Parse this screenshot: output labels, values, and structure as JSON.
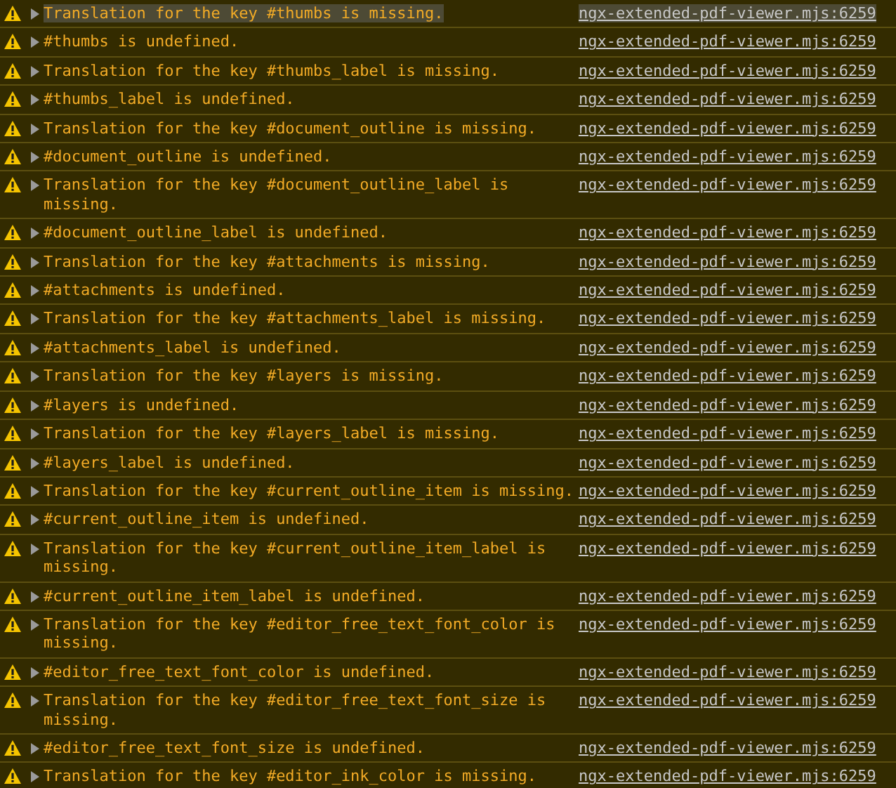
{
  "console": {
    "messages": [
      {
        "text": "Translation for the key #thumbs is missing.",
        "source": "ngx-extended-pdf-viewer.mjs:6259",
        "selected": true
      },
      {
        "text": "#thumbs is undefined.",
        "source": "ngx-extended-pdf-viewer.mjs:6259",
        "selected": false
      },
      {
        "text": "Translation for the key #thumbs_label is missing.",
        "source": "ngx-extended-pdf-viewer.mjs:6259",
        "selected": false
      },
      {
        "text": "#thumbs_label is undefined.",
        "source": "ngx-extended-pdf-viewer.mjs:6259",
        "selected": false
      },
      {
        "text": "Translation for the key #document_outline is missing.",
        "source": "ngx-extended-pdf-viewer.mjs:6259",
        "selected": false
      },
      {
        "text": "#document_outline is undefined.",
        "source": "ngx-extended-pdf-viewer.mjs:6259",
        "selected": false
      },
      {
        "text": "Translation for the key #document_outline_label is missing.",
        "source": "ngx-extended-pdf-viewer.mjs:6259",
        "selected": false
      },
      {
        "text": "#document_outline_label is undefined.",
        "source": "ngx-extended-pdf-viewer.mjs:6259",
        "selected": false
      },
      {
        "text": "Translation for the key #attachments is missing.",
        "source": "ngx-extended-pdf-viewer.mjs:6259",
        "selected": false
      },
      {
        "text": "#attachments is undefined.",
        "source": "ngx-extended-pdf-viewer.mjs:6259",
        "selected": false
      },
      {
        "text": "Translation for the key #attachments_label is missing.",
        "source": "ngx-extended-pdf-viewer.mjs:6259",
        "selected": false
      },
      {
        "text": "#attachments_label is undefined.",
        "source": "ngx-extended-pdf-viewer.mjs:6259",
        "selected": false
      },
      {
        "text": "Translation for the key #layers is missing.",
        "source": "ngx-extended-pdf-viewer.mjs:6259",
        "selected": false
      },
      {
        "text": "#layers is undefined.",
        "source": "ngx-extended-pdf-viewer.mjs:6259",
        "selected": false
      },
      {
        "text": "Translation for the key #layers_label is missing.",
        "source": "ngx-extended-pdf-viewer.mjs:6259",
        "selected": false
      },
      {
        "text": "#layers_label is undefined.",
        "source": "ngx-extended-pdf-viewer.mjs:6259",
        "selected": false
      },
      {
        "text": "Translation for the key #current_outline_item is missing.",
        "source": "ngx-extended-pdf-viewer.mjs:6259",
        "selected": false
      },
      {
        "text": "#current_outline_item is undefined.",
        "source": "ngx-extended-pdf-viewer.mjs:6259",
        "selected": false
      },
      {
        "text": "Translation for the key #current_outline_item_label is missing.",
        "source": "ngx-extended-pdf-viewer.mjs:6259",
        "selected": false
      },
      {
        "text": "#current_outline_item_label is undefined.",
        "source": "ngx-extended-pdf-viewer.mjs:6259",
        "selected": false
      },
      {
        "text": "Translation for the key #editor_free_text_font_color is missing.",
        "source": "ngx-extended-pdf-viewer.mjs:6259",
        "selected": false
      },
      {
        "text": "#editor_free_text_font_color is undefined.",
        "source": "ngx-extended-pdf-viewer.mjs:6259",
        "selected": false
      },
      {
        "text": "Translation for the key #editor_free_text_font_size is missing.",
        "source": "ngx-extended-pdf-viewer.mjs:6259",
        "selected": false
      },
      {
        "text": "#editor_free_text_font_size is undefined.",
        "source": "ngx-extended-pdf-viewer.mjs:6259",
        "selected": false
      },
      {
        "text": "Translation for the key #editor_ink_color is missing.",
        "source": "ngx-extended-pdf-viewer.mjs:6259",
        "selected": false
      }
    ]
  }
}
